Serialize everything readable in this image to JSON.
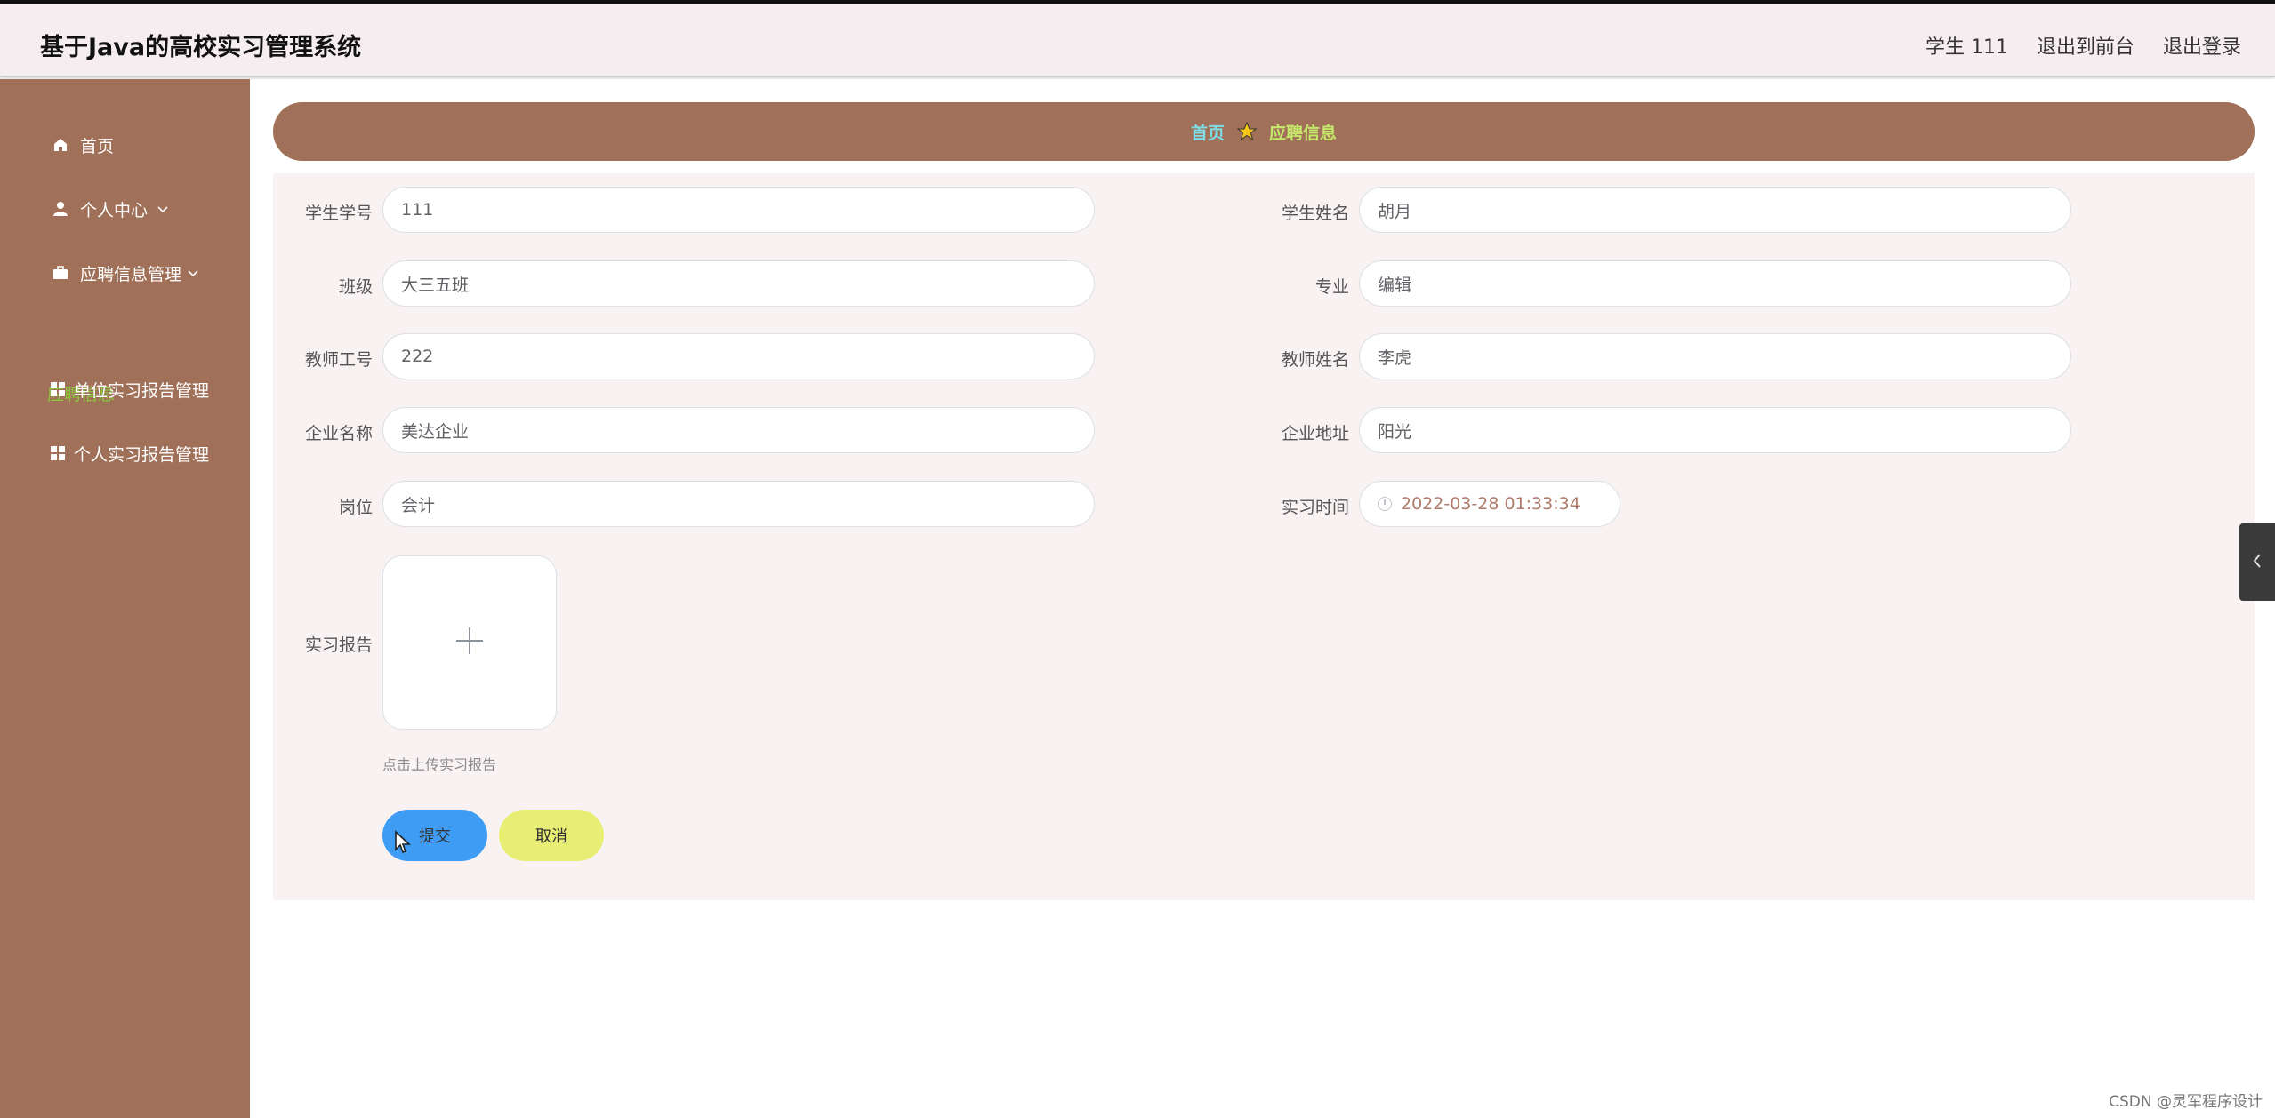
{
  "app": {
    "title": "基于Java的高校实习管理系统"
  },
  "header": {
    "user": "学生 111",
    "to_front": "退出到前台",
    "logout": "退出登录"
  },
  "sidebar": {
    "items": [
      {
        "label": "首页",
        "icon": "home-icon"
      },
      {
        "label": "个人中心",
        "icon": "user-icon"
      },
      {
        "label": "应聘信息管理",
        "icon": "briefcase-icon"
      },
      {
        "label": "单位实习报告管理",
        "icon": "grid-icon"
      },
      {
        "label": "个人实习报告管理",
        "icon": "grid-icon"
      }
    ],
    "active_sub": "应聘信息"
  },
  "breadcrumb": {
    "home": "首页",
    "current": "应聘信息"
  },
  "form": {
    "student_no": {
      "label": "学生学号",
      "value": "111"
    },
    "student_name": {
      "label": "学生姓名",
      "value": "胡月"
    },
    "class": {
      "label": "班级",
      "value": "大三五班"
    },
    "major": {
      "label": "专业",
      "value": "编辑"
    },
    "teacher_no": {
      "label": "教师工号",
      "value": "222"
    },
    "teacher_name": {
      "label": "教师姓名",
      "value": "李虎"
    },
    "company": {
      "label": "企业名称",
      "value": "美达企业"
    },
    "address": {
      "label": "企业地址",
      "value": "阳光"
    },
    "position": {
      "label": "岗位",
      "value": "会计"
    },
    "intern_time": {
      "label": "实习时间",
      "value": "2022-03-28 01:33:34"
    },
    "report": {
      "label": "实习报告",
      "hint": "点击上传实习报告"
    },
    "submit": "提交",
    "cancel": "取消"
  },
  "watermark": "CSDN @灵军程序设计",
  "colors": {
    "sidebar": "#a07058",
    "header": "#f6edf0",
    "submit": "#3f9cf4",
    "cancel": "#e8ee74",
    "active_sub": "#8ac640"
  }
}
